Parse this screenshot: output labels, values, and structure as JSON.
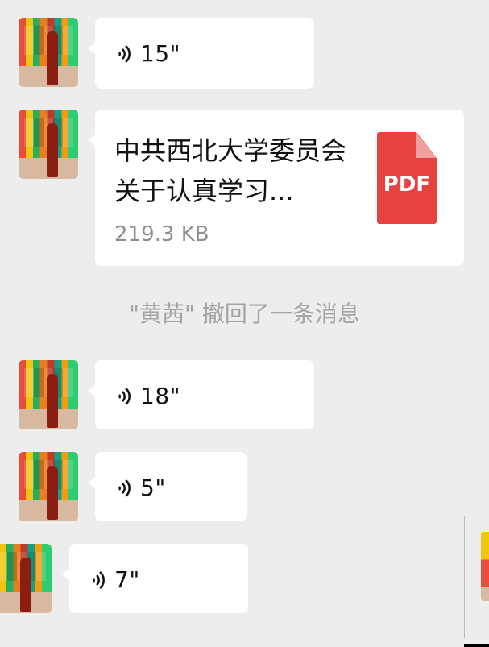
{
  "messages": [
    {
      "type": "voice",
      "duration": "15\""
    },
    {
      "type": "file",
      "title": "中共西北大学委员会关于认真学习...",
      "size": "219.3 KB",
      "file_type": "PDF",
      "icon_color": "#e64340"
    },
    {
      "type": "voice",
      "duration": "18\""
    },
    {
      "type": "voice",
      "duration": "5\""
    },
    {
      "type": "voice",
      "duration": "7\""
    }
  ],
  "system_notice": "\"黄茜\" 撤回了一条消息"
}
